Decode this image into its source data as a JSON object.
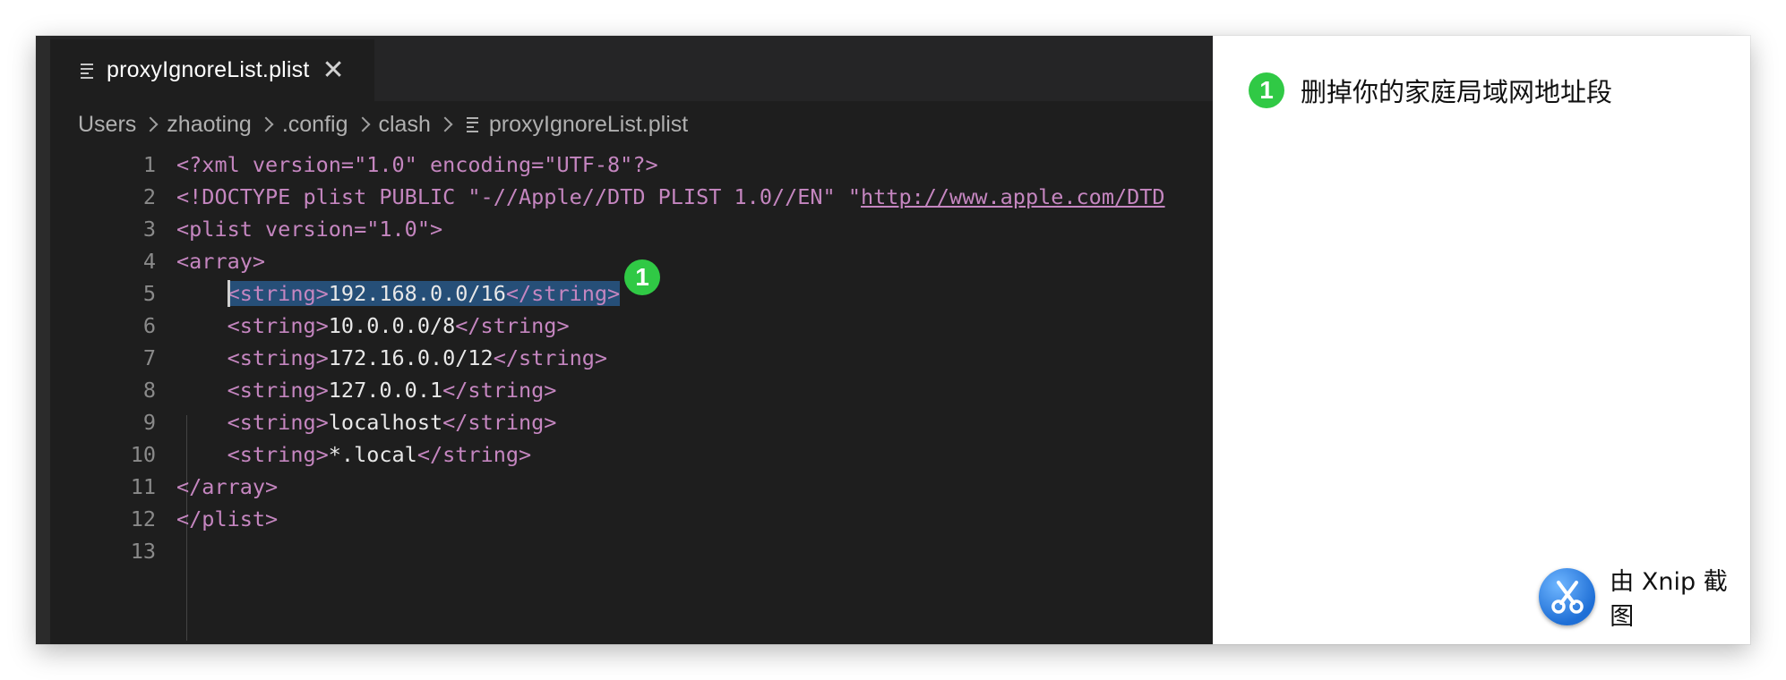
{
  "tab": {
    "label": "proxyIgnoreList.plist",
    "close": "✕"
  },
  "breadcrumb": [
    "Users",
    "zhaoting",
    ".config",
    "clash",
    "proxyIgnoreList.plist"
  ],
  "code_lines": [
    {
      "n": "1",
      "parts": [
        {
          "t": "tag",
          "v": "<?xml version=\"1.0\" encoding=\"UTF-8\"?>"
        }
      ]
    },
    {
      "n": "2",
      "parts": [
        {
          "t": "tag",
          "v": "<!DOCTYPE plist PUBLIC \"-//Apple//DTD PLIST 1.0//EN\" \""
        },
        {
          "t": "link",
          "v": "http://www.apple.com/DTD"
        }
      ]
    },
    {
      "n": "3",
      "parts": [
        {
          "t": "tag",
          "v": "<plist version=\"1.0\">"
        }
      ]
    },
    {
      "n": "4",
      "parts": [
        {
          "t": "tag",
          "v": "<array>"
        }
      ]
    },
    {
      "n": "5",
      "indent": "    ",
      "highlight": true,
      "cursor": true,
      "parts": [
        {
          "t": "tag",
          "v": "<string>"
        },
        {
          "t": "txt",
          "v": "192.168.0.0/16"
        },
        {
          "t": "tag",
          "v": "</string>"
        }
      ]
    },
    {
      "n": "6",
      "indent": "    ",
      "parts": [
        {
          "t": "tag",
          "v": "<string>"
        },
        {
          "t": "txt",
          "v": "10.0.0.0/8"
        },
        {
          "t": "tag",
          "v": "</string>"
        }
      ]
    },
    {
      "n": "7",
      "indent": "    ",
      "parts": [
        {
          "t": "tag",
          "v": "<string>"
        },
        {
          "t": "txt",
          "v": "172.16.0.0/12"
        },
        {
          "t": "tag",
          "v": "</string>"
        }
      ]
    },
    {
      "n": "8",
      "indent": "    ",
      "parts": [
        {
          "t": "tag",
          "v": "<string>"
        },
        {
          "t": "txt",
          "v": "127.0.0.1"
        },
        {
          "t": "tag",
          "v": "</string>"
        }
      ]
    },
    {
      "n": "9",
      "indent": "    ",
      "parts": [
        {
          "t": "tag",
          "v": "<string>"
        },
        {
          "t": "txt",
          "v": "localhost"
        },
        {
          "t": "tag",
          "v": "</string>"
        }
      ]
    },
    {
      "n": "10",
      "indent": "    ",
      "parts": [
        {
          "t": "tag",
          "v": "<string>"
        },
        {
          "t": "txt",
          "v": "*.local"
        },
        {
          "t": "tag",
          "v": "</string>"
        }
      ]
    },
    {
      "n": "11",
      "parts": [
        {
          "t": "tag",
          "v": "</array>"
        }
      ]
    },
    {
      "n": "12",
      "parts": [
        {
          "t": "tag",
          "v": "</plist>"
        }
      ]
    },
    {
      "n": "13",
      "parts": []
    }
  ],
  "annotation": {
    "number": "1",
    "text": "删掉你的家庭局域网地址段"
  },
  "watermark": {
    "text": "由 Xnip 截图",
    "icon": "scissors-icon"
  },
  "colors": {
    "editor_bg": "#1e1e1e",
    "tag": "#c586c0",
    "text": "#e8e8e8",
    "selection": "#264f78",
    "badge": "#30c945"
  }
}
